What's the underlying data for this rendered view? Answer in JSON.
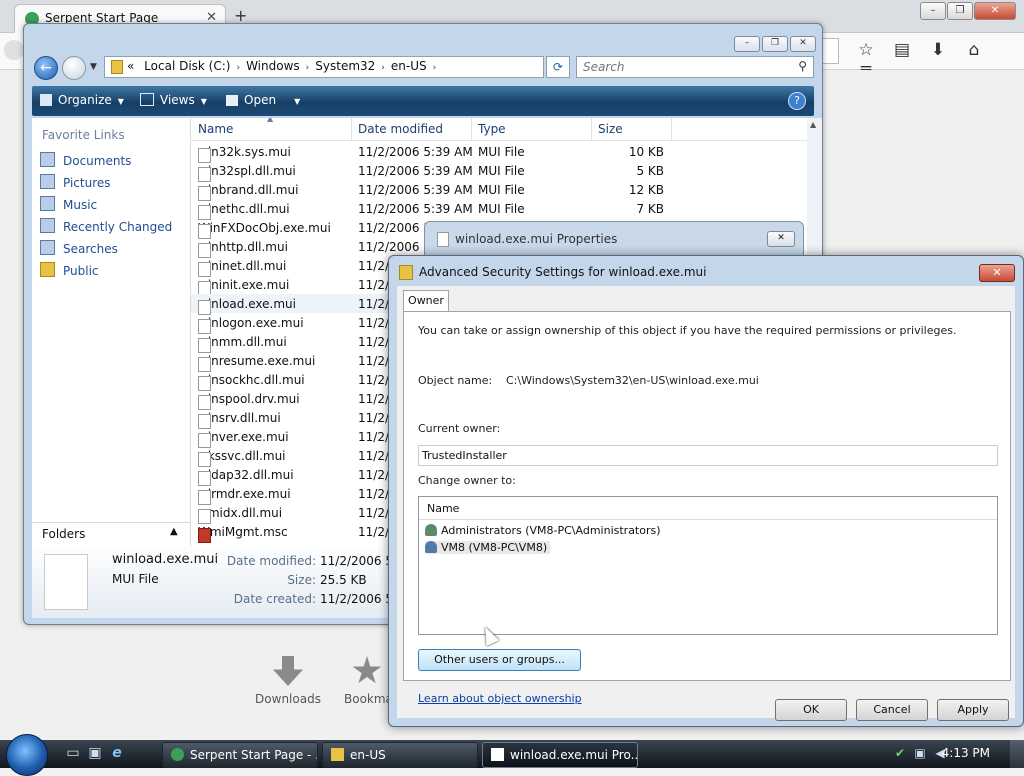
{
  "browser": {
    "tab_title": "Serpent Start Page",
    "tab_close": "✕",
    "new_tab": "+",
    "window_controls": [
      "–",
      "❐",
      "✕"
    ],
    "toolbar_icons": [
      "☆",
      "▤",
      "⬇",
      "⌂",
      "≡"
    ],
    "tiles": [
      "Downloads",
      "Bookma"
    ]
  },
  "explorer": {
    "controls": [
      "–",
      "❐",
      "✕"
    ],
    "address": {
      "overflow": "«",
      "crumbs": [
        "Local Disk (C:)",
        "Windows",
        "System32",
        "en-US"
      ]
    },
    "search_placeholder": "Search",
    "toolbar": {
      "organize": "Organize",
      "views": "Views",
      "open": "Open",
      "help": "?"
    },
    "favorites_title": "Favorite Links",
    "favorites": [
      "Documents",
      "Pictures",
      "Music",
      "Recently Changed",
      "Searches",
      "Public"
    ],
    "folders_label": "Folders",
    "columns": [
      "Name",
      "Date modified",
      "Type",
      "Size"
    ],
    "files": [
      {
        "name": "win32k.sys.mui",
        "date": "11/2/2006 5:39 AM",
        "type": "MUI File",
        "size": "10 KB"
      },
      {
        "name": "win32spl.dll.mui",
        "date": "11/2/2006 5:39 AM",
        "type": "MUI File",
        "size": "5 KB"
      },
      {
        "name": "winbrand.dll.mui",
        "date": "11/2/2006 5:39 AM",
        "type": "MUI File",
        "size": "12 KB"
      },
      {
        "name": "winethc.dll.mui",
        "date": "11/2/2006 5:39 AM",
        "type": "MUI File",
        "size": "7 KB"
      },
      {
        "name": "WinFXDocObj.exe.mui",
        "date": "11/2/2006 5:39",
        "type": "",
        "size": ""
      },
      {
        "name": "winhttp.dll.mui",
        "date": "11/2/2006 5:39",
        "type": "",
        "size": ""
      },
      {
        "name": "wininet.dll.mui",
        "date": "11/2/",
        "type": "",
        "size": ""
      },
      {
        "name": "wininit.exe.mui",
        "date": "11/2/",
        "type": "",
        "size": ""
      },
      {
        "name": "winload.exe.mui",
        "date": "11/2/",
        "type": "",
        "size": ""
      },
      {
        "name": "winlogon.exe.mui",
        "date": "11/2/",
        "type": "",
        "size": ""
      },
      {
        "name": "winmm.dll.mui",
        "date": "11/2/",
        "type": "",
        "size": ""
      },
      {
        "name": "winresume.exe.mui",
        "date": "11/2/",
        "type": "",
        "size": ""
      },
      {
        "name": "winsockhc.dll.mui",
        "date": "11/2/",
        "type": "",
        "size": ""
      },
      {
        "name": "winspool.drv.mui",
        "date": "11/2/",
        "type": "",
        "size": ""
      },
      {
        "name": "winsrv.dll.mui",
        "date": "11/2/",
        "type": "",
        "size": ""
      },
      {
        "name": "winver.exe.mui",
        "date": "11/2/",
        "type": "",
        "size": ""
      },
      {
        "name": "wkssvc.dll.mui",
        "date": "11/2/",
        "type": "",
        "size": ""
      },
      {
        "name": "wldap32.dll.mui",
        "date": "11/2/",
        "type": "",
        "size": ""
      },
      {
        "name": "wlrmdr.exe.mui",
        "date": "11/2/",
        "type": "",
        "size": ""
      },
      {
        "name": "wmidx.dll.mui",
        "date": "11/2/",
        "type": "",
        "size": ""
      },
      {
        "name": "WmiMgmt.msc",
        "date": "11/2/",
        "type": "",
        "size": ""
      }
    ],
    "details": {
      "name": "winload.exe.mui",
      "type": "MUI File",
      "date_modified_label": "Date modified:",
      "date_modified": "11/2/2006 5:39 AM",
      "size_label": "Size:",
      "size": "25.5 KB",
      "date_created_label": "Date created:",
      "date_created": "11/2/2006 5:42 AM"
    }
  },
  "properties_dialog": {
    "title": "winload.exe.mui Properties",
    "close": "✕"
  },
  "advanced_dialog": {
    "title": "Advanced Security Settings for winload.exe.mui",
    "close": "✕",
    "tab_owner": "Owner",
    "intro": "You can take or assign ownership of this object if you have the required permissions or privileges.",
    "object_name_label": "Object name:",
    "object_name": "C:\\Windows\\System32\\en-US\\winload.exe.mui",
    "current_owner_label": "Current owner:",
    "current_owner": "TrustedInstaller",
    "change_owner_label": "Change owner to:",
    "list_header": "Name",
    "owners": [
      "Administrators (VM8-PC\\Administrators)",
      "VM8 (VM8-PC\\VM8)"
    ],
    "other_users_button": "Other users or groups...",
    "learn_link": "Learn about object ownership",
    "ok": "OK",
    "cancel": "Cancel",
    "apply": "Apply"
  },
  "taskbar": {
    "quick_launch": [
      "▭",
      "▣",
      "e"
    ],
    "tasks": [
      "Serpent Start Page - ...",
      "en-US",
      "winload.exe.mui Pro..."
    ],
    "tray_icons": [
      "✔",
      "▣",
      "◀"
    ],
    "clock": "4:13 PM"
  }
}
